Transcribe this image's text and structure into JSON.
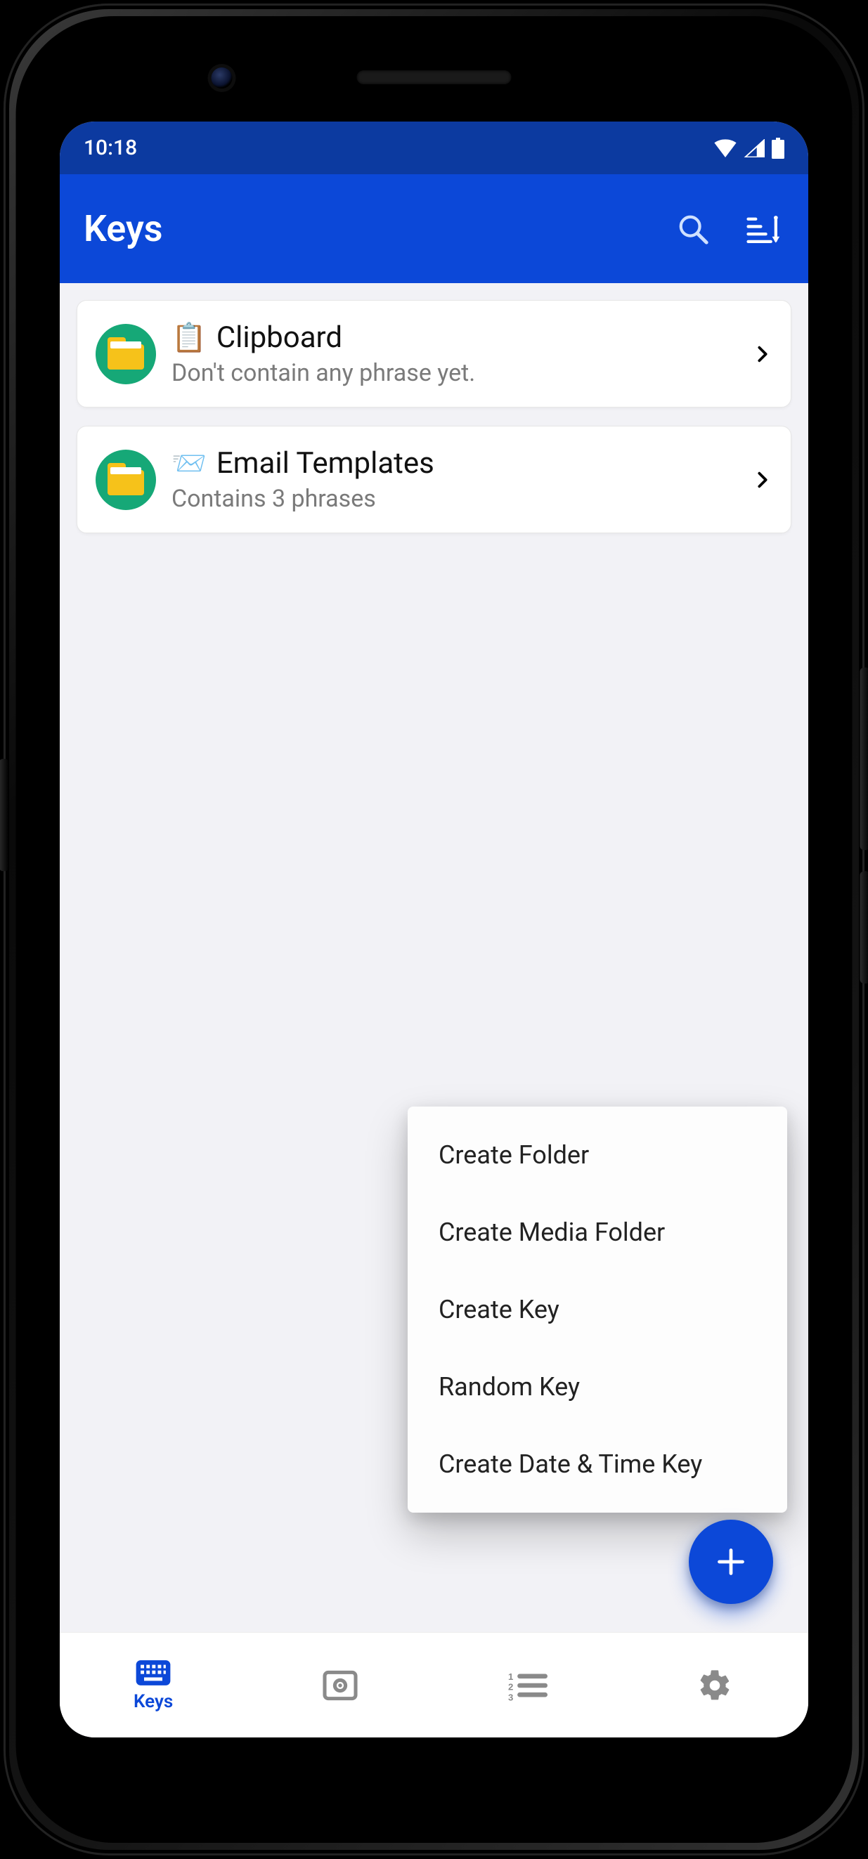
{
  "status": {
    "time": "10:18"
  },
  "appbar": {
    "title": "Keys"
  },
  "folders": [
    {
      "emoji": "📋",
      "title": "Clipboard",
      "subtitle": "Don't contain any phrase yet."
    },
    {
      "emoji": "📨",
      "title": "Email Templates",
      "subtitle": "Contains 3 phrases"
    }
  ],
  "fab_menu": {
    "items": [
      "Create Folder",
      "Create Media Folder",
      "Create Key",
      "Random Key",
      "Create Date & Time Key"
    ]
  },
  "bottom_nav": {
    "items": [
      {
        "id": "keys",
        "label": "Keys",
        "active": true
      },
      {
        "id": "media",
        "label": "",
        "active": false
      },
      {
        "id": "list",
        "label": "",
        "active": false
      },
      {
        "id": "settings",
        "label": "",
        "active": false
      }
    ]
  }
}
